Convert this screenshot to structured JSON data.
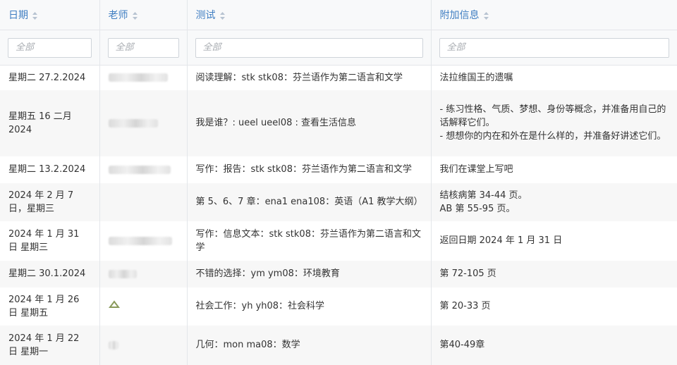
{
  "headers": [
    "日期",
    "老师",
    "测试",
    "附加信息"
  ],
  "filters": [
    {
      "placeholder": "全部"
    },
    {
      "placeholder": "全部"
    },
    {
      "placeholder": "全部"
    },
    {
      "placeholder": "全部"
    }
  ],
  "rows": [
    {
      "date": "星期二 27.2.2024",
      "test": "阅读理解：stk stk08：芬兰语作为第二语言和文学",
      "extra": [
        "法拉维国王的遗嘱"
      ]
    },
    {
      "date": "星期五 16 二月 2024",
      "test": "我是谁？: ueel ueel08 : 查看生活信息",
      "extra": [
        "- 练习性格、气质、梦想、身份等概念，并准备用自己的话解释它们。",
        "- 想想你的内在和外在是什么样的，并准备好讲述它们。"
      ]
    },
    {
      "date": "星期二 13.2.2024",
      "test": "写作：报告：stk stk08：芬兰语作为第二语言和文学",
      "extra": [
        "我们在课堂上写吧"
      ]
    },
    {
      "date": "2024 年 2 月 7 日，星期三",
      "test": "第 5、6、7 章：ena1 ena108：英语（A1 教学大纲）",
      "extra": [
        "结核病第 34-44 页。",
        "AB 第 55-95 页。"
      ]
    },
    {
      "date": "2024 年 1 月 31 日 星期三",
      "test": "写作：信息文本：stk stk08：芬兰语作为第二语言和文学",
      "extra": [
        "返回日期 2024 年 1 月 31 日"
      ]
    },
    {
      "date": "星期二 30.1.2024",
      "test": "不错的选择：ym ym08：环境教育",
      "extra": [
        "第 72-105 页"
      ]
    },
    {
      "date": "2024 年 1 月 26 日 星期五",
      "test": "社会工作：yh yh08：社会科学",
      "extra": [
        "第 20-33 页"
      ]
    },
    {
      "date": "2024 年 1 月 22 日 星期一",
      "test": "几何：mon ma08：数学",
      "extra": [
        "第40-49章"
      ]
    }
  ],
  "colors": {
    "header_text": "#3f7ec2",
    "header_bg": "#f8f9fa",
    "row_alt": "#f7f7f7",
    "border": "#e3e6ea"
  }
}
